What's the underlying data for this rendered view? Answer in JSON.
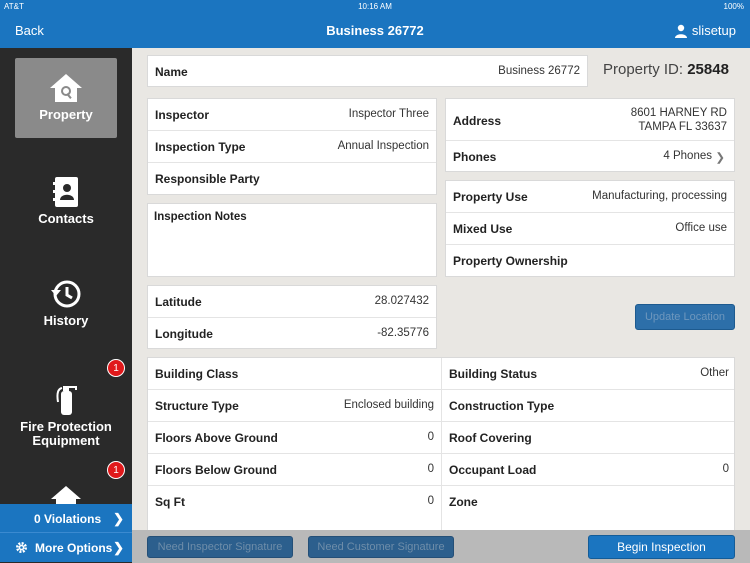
{
  "status": {
    "carrier": "AT&T",
    "time": "10:16 AM",
    "battery": "100%"
  },
  "nav": {
    "back": "Back",
    "title": "Business 26772",
    "user": "slisetup"
  },
  "sidebar": {
    "items": [
      {
        "label": "Property",
        "icon": "home-icon"
      },
      {
        "label": "Contacts",
        "icon": "contacts-icon"
      },
      {
        "label": "History",
        "icon": "history-icon"
      },
      {
        "label": "Fire Protection Equipment",
        "icon": "fire-extinguisher-icon",
        "badge": "1"
      },
      {
        "label": "",
        "icon": "home-icon",
        "badge": "1"
      }
    ],
    "violations": "0 Violations",
    "more": "More Options"
  },
  "name": {
    "label": "Name",
    "value": "Business 26772"
  },
  "property_id": {
    "label": "Property ID:",
    "value": "25848"
  },
  "inspection": [
    {
      "label": "Inspector",
      "value": "Inspector Three"
    },
    {
      "label": "Inspection Type",
      "value": "Annual Inspection"
    },
    {
      "label": "Responsible Party",
      "value": ""
    }
  ],
  "notes_label": "Inspection Notes",
  "location": [
    {
      "label": "Latitude",
      "value": "28.027432"
    },
    {
      "label": "Longitude",
      "value": "-82.35776"
    }
  ],
  "address": {
    "label": "Address",
    "line1": "8601  HARNEY RD",
    "line2": "TAMPA FL 33637"
  },
  "phones": {
    "label": "Phones",
    "value": "4 Phones"
  },
  "use": [
    {
      "label": "Property Use",
      "value": "Manufacturing, processing"
    },
    {
      "label": "Mixed Use",
      "value": "Office use"
    },
    {
      "label": "Property Ownership",
      "value": ""
    }
  ],
  "update_location": "Update Location",
  "building_left": [
    {
      "label": "Building Class",
      "value": ""
    },
    {
      "label": "Structure Type",
      "value": "Enclosed building"
    },
    {
      "label": "Floors Above Ground",
      "value": "0"
    },
    {
      "label": "Floors Below Ground",
      "value": "0"
    },
    {
      "label": "Sq Ft",
      "value": "0"
    }
  ],
  "building_right": [
    {
      "label": "Building Status",
      "value": "Other"
    },
    {
      "label": "Construction Type",
      "value": ""
    },
    {
      "label": "Roof Covering",
      "value": ""
    },
    {
      "label": "Occupant Load",
      "value": "0"
    },
    {
      "label": "Zone",
      "value": ""
    }
  ],
  "buttons": {
    "insp_sig": "Need Inspector Signature",
    "cust_sig": "Need Customer Signature",
    "begin": "Begin Inspection"
  },
  "colors": {
    "accent": "#1b75c0",
    "sidebar": "#2a2a2a",
    "badge": "#e0191b"
  }
}
